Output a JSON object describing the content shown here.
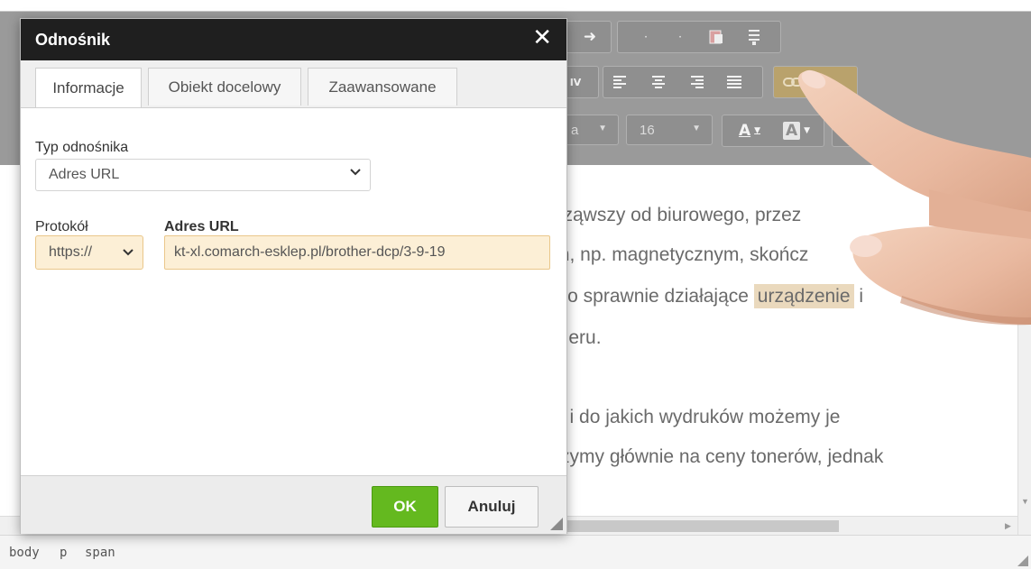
{
  "dialog": {
    "title": "Odnośnik",
    "close_glyph": "✕",
    "tabs": [
      {
        "label": "Informacje",
        "active": true
      },
      {
        "label": "Obiekt docelowy",
        "active": false
      },
      {
        "label": "Zaawansowane",
        "active": false
      }
    ],
    "link_type_label": "Typ odnośnika",
    "link_type_value": "Adres URL",
    "protocol_label": "Protokół",
    "protocol_value": "https://",
    "url_label": "Adres URL",
    "url_value": "kt-xl.comarch-esklep.pl/brother-dcp/3-9-19",
    "ok_label": "OK",
    "cancel_label": "Anuluj"
  },
  "toolbar": {
    "font_size_value": "16",
    "font_name_value": "a",
    "text_color_label": "A",
    "bg_color_label": "A",
    "bidi_label": "IV",
    "icons": [
      "undo-icon",
      "redo-icon",
      "paste-word-icon",
      "clipboard-icon",
      "bidi-icon",
      "align-left-icon",
      "align-center-icon",
      "align-right-icon",
      "align-justify-icon",
      "link-icon",
      "text-color-icon",
      "bg-color-icon",
      "maximize-icon"
    ]
  },
  "content": {
    "lines": [
      "cząwszy od biurowego, przez",
      "m, np. magnetycznym, skończ",
      "lko sprawnie działające ",
      "pieru.",
      "u i do jakich wydruków możemy je",
      "rzymy głównie na ceny tonerów, jednak"
    ],
    "highlight_word": "urządzenie",
    "after_highlight": " i"
  },
  "statusbar": {
    "path": [
      "body",
      "p",
      "span"
    ]
  },
  "colors": {
    "ok_green": "#64b91f",
    "focus_field": "#fcefd6",
    "title_bar": "#1f1f1f",
    "highlight": "#ead9bd"
  }
}
